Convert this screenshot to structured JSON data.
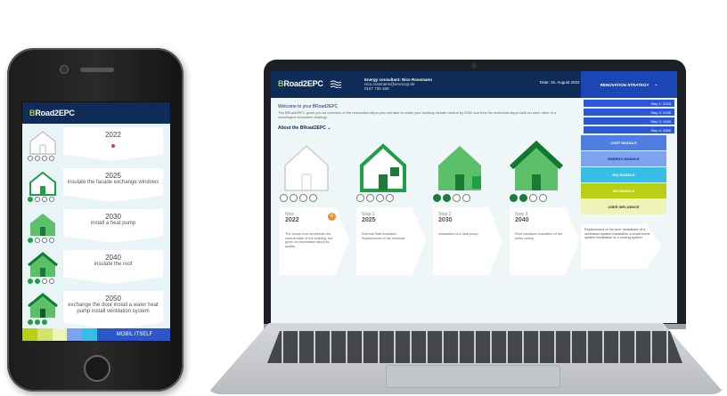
{
  "brand": {
    "logo_b": "B",
    "logo_rest": "Road2EPC"
  },
  "phone": {
    "steps": [
      {
        "year": "2022",
        "text": ""
      },
      {
        "year": "2025",
        "text": "insulate the facade exchange windows"
      },
      {
        "year": "2030",
        "text": "install a heat pump"
      },
      {
        "year": "2040",
        "text": "insulate the roof"
      },
      {
        "year": "2050",
        "text": "exchange the door install a water heat pump install ventilation system"
      }
    ],
    "bottom_button": "MOBIL ITSELF"
  },
  "laptop": {
    "header": {
      "meta_line1": "Energy consultant:   Nico Rossmann",
      "meta_line2": "nico.rossmann@eroncup.de",
      "meta_line3": "0157 735 369",
      "date": "Date:   16. August 2022"
    },
    "welcome": "Welcome to your BRoad2EPC",
    "intro": "The BRoad2EPC gives you an overview of the renovation steps you can take to make your building climate neutral by 2050 and how the individual steps build on each other in a meaningful renovation strategy.",
    "about": "About the BRoad2EPC",
    "stages": [
      {
        "label": "Now",
        "year": "2022",
        "desc": "The house icon represents the current state of the building, but gives no information about its quality.",
        "badge": "G"
      },
      {
        "label": "Step 1",
        "year": "2025",
        "desc": "External Wall insulation Replacement of the windows",
        "badge": ""
      },
      {
        "label": "Step 2",
        "year": "2030",
        "desc": "Installation of a heat pump",
        "badge": ""
      },
      {
        "label": "Step 3",
        "year": "2040",
        "desc": "Roof insulation Insulation of the cellar ceiling",
        "badge": ""
      }
    ],
    "sidebar": {
      "renovation_button": "RENOVATION STRATEGY",
      "steps": [
        "Step 1: 2025",
        "Step 2: 2030",
        "Step 3: 2040",
        "Step 4: 2050"
      ],
      "modules": [
        {
          "label": "COST MODULE",
          "color": "#4f7de0",
          "text_color": "#ffffff"
        },
        {
          "label": "ENERGY MODULE",
          "color": "#7ea2f0",
          "text_color": "#0f2b58"
        },
        {
          "label": "IEQ MODULE",
          "color": "#38bde6",
          "text_color": "#ffffff"
        },
        {
          "label": "SRI MODULE",
          "color": "#b9cf14",
          "text_color": "#ffffff"
        },
        {
          "label": "USER INFLUENCE",
          "color": "#eef3b8",
          "text_color": "#333333"
        }
      ],
      "card_text": "Replacement of the door Installation of a ventilation system Installation a smart home system Installation of a cooling system"
    }
  }
}
